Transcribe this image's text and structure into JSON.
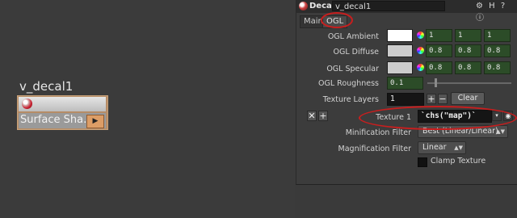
{
  "network": {
    "node_name": "v_decal1",
    "node_label": "Surface Sha...",
    "node_flag": "▶"
  },
  "panel": {
    "node_type": "Decal",
    "node_name": "v_decal1",
    "title_icons": "⚙ H ? ⓘ",
    "tabs": [
      {
        "label": "Main",
        "active": false
      },
      {
        "label": "OGL",
        "active": true
      }
    ],
    "params": {
      "ogl_ambient": {
        "label": "OGL Ambient",
        "swatch": "#ffffff",
        "values": [
          "1",
          "1",
          "1"
        ]
      },
      "ogl_diffuse": {
        "label": "OGL Diffuse",
        "swatch": "#cccccc",
        "values": [
          "0.8",
          "0.8",
          "0.8"
        ]
      },
      "ogl_specular": {
        "label": "OGL Specular",
        "swatch": "#cccccc",
        "values": [
          "0.8",
          "0.8",
          "0.8"
        ]
      },
      "ogl_roughness": {
        "label": "OGL Roughness",
        "value": "0.1",
        "slider_fraction": 0.1
      },
      "texture_layers": {
        "label": "Texture Layers",
        "value": "1",
        "plus": "+",
        "minus": "−",
        "clear": "Clear"
      },
      "texture_1": {
        "label": "Texture 1",
        "value": "`chs(\"map\")`",
        "remove": "✕",
        "add": "+"
      },
      "minification_filter": {
        "label": "Minification Filter",
        "value": "Best (Linear/Linear)"
      },
      "magnification_filter": {
        "label": "Magnification Filter",
        "value": "Linear"
      },
      "clamp_texture": {
        "label": "Clamp Texture",
        "checked": false
      }
    }
  },
  "colors": {
    "annotation_ring": "#c81e1e",
    "numeric_field": "#2c4c28",
    "node_body": "#b68c66"
  },
  "icons": [
    "node-shader-icon",
    "close-icon",
    "add-icon",
    "file-browse-icon",
    "dropdown-arrow-icon"
  ]
}
